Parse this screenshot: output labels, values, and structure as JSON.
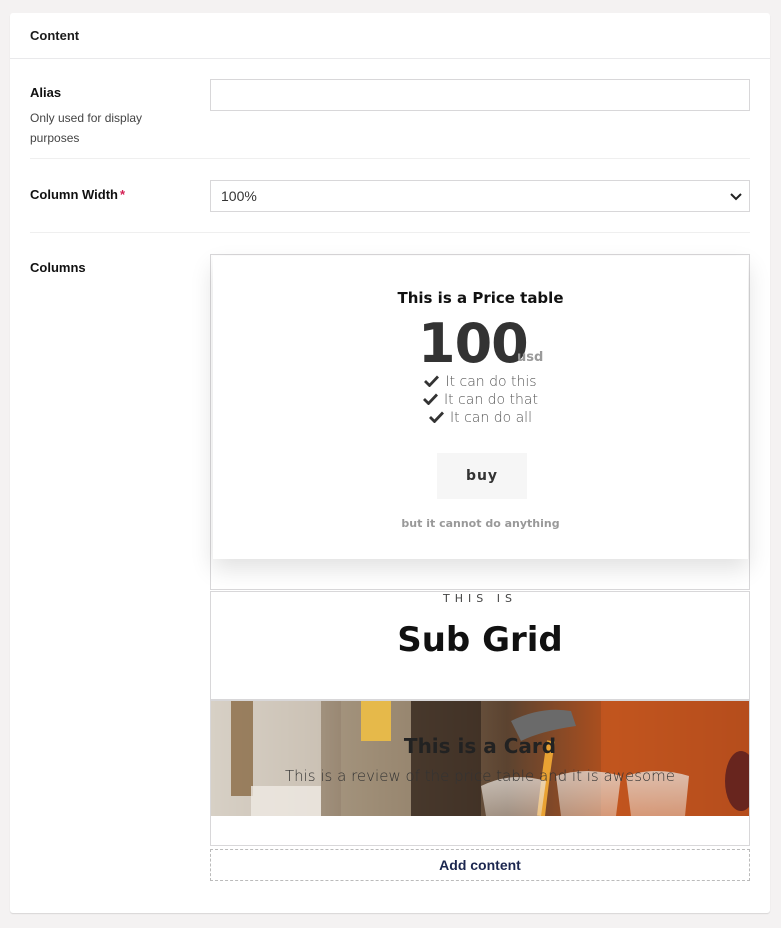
{
  "panel": {
    "title": "Content"
  },
  "alias": {
    "label": "Alias",
    "description": "Only used for display purposes",
    "value": "",
    "placeholder": ""
  },
  "column_width": {
    "label": "Column Width",
    "required_mark": "*",
    "selected": "100%"
  },
  "columns": {
    "label": "Columns",
    "price_table": {
      "title": "This is a Price table",
      "amount": "100",
      "unit": "usd",
      "features": [
        "It can do this",
        "It can do that",
        "It can do all"
      ],
      "button": "buy",
      "footnote": "but it cannot do anything"
    },
    "sub_grid": {
      "eyebrow": "THIS IS",
      "title": "Sub Grid"
    },
    "card": {
      "title": "This is a Card",
      "text": "This is a review of the price table and it is awesome"
    },
    "add_content": "Add content"
  },
  "colors": {
    "accent": "#1b264f",
    "required": "#d42054",
    "border": "#d8d7d9"
  },
  "icons": {
    "check": "check-icon",
    "select_arrow": "chevron-down-icon"
  }
}
